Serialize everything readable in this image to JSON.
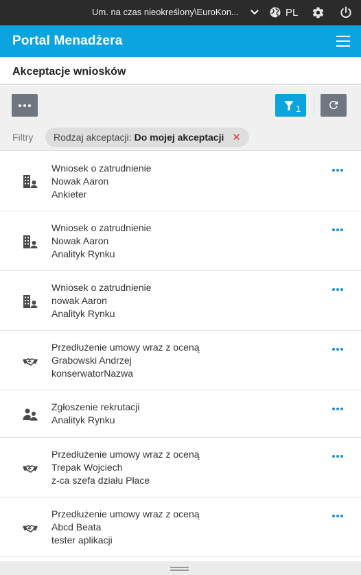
{
  "topbar": {
    "context": "Um. na czas nieokreślony\\EuroKon...",
    "language": "PL"
  },
  "header": {
    "app_title": "Portal Menadżera"
  },
  "page": {
    "title": "Akceptacje wniosków"
  },
  "toolbar": {
    "active_filter_count": "1",
    "filters_label": "Filtry",
    "chip": {
      "key": "Rodzaj akceptacji:",
      "value": "Do mojej akceptacji",
      "remove": "✕"
    }
  },
  "requests": [
    {
      "icon": "building-person-icon",
      "line1": "Wniosek o zatrudnienie",
      "line2": "Nowak Aaron",
      "line3": "Ankieter"
    },
    {
      "icon": "building-person-icon",
      "line1": "Wniosek o zatrudnienie",
      "line2": "Nowak Aaron",
      "line3": "Analityk Rynku"
    },
    {
      "icon": "building-person-icon",
      "line1": "Wniosek o zatrudnienie",
      "line2": "nowak Aaron",
      "line3": "Analityk Rynku"
    },
    {
      "icon": "handshake-icon",
      "line1": "Przedłużenie umowy wraz z oceną",
      "line2": "Grabowski Andrzej",
      "line3": "konserwatorNazwa"
    },
    {
      "icon": "recruitment-icon",
      "line1": "Zgłoszenie rekrutacji",
      "line2": "Analityk Rynku"
    },
    {
      "icon": "handshake-icon",
      "line1": "Przedłużenie umowy wraz z oceną",
      "line2": "Trepak Wojciech",
      "line3": "z-ca szefa działu Płace"
    },
    {
      "icon": "handshake-icon",
      "line1": "Przedłużenie umowy wraz z oceną",
      "line2": "Abcd Beata",
      "line3": "tester aplikacji"
    }
  ],
  "colors": {
    "topbar": "#2b2b2b",
    "brand": "#0ba4df",
    "toolbar_bg": "#f0f0f0",
    "secondary_button": "#6f7680",
    "more_dots": "#1b8fd3",
    "chip_remove": "#e53935"
  }
}
